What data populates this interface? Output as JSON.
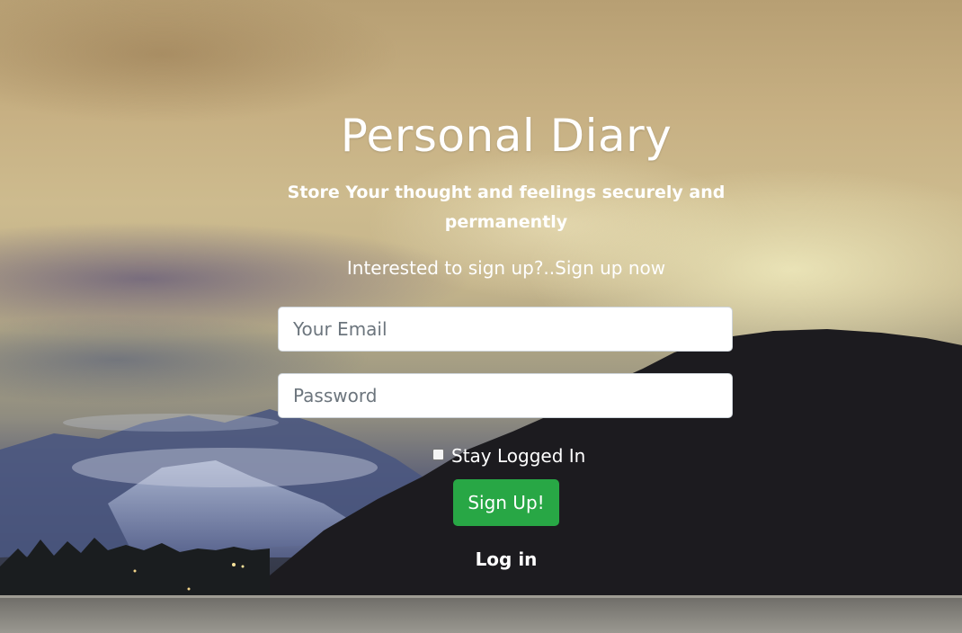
{
  "header": {
    "title": "Personal Diary",
    "subtitle": "Store Your thought and feelings securely and permanently"
  },
  "signup_form": {
    "invite_text": "Interested to sign up?..Sign up now",
    "email_placeholder": "Your Email",
    "password_placeholder": "Password",
    "stay_logged_in_label": "Stay Logged In",
    "stay_logged_in_checked": false,
    "submit_label": "Sign Up!",
    "toggle_link_label": "Log in"
  },
  "colors": {
    "submit_button": "#28a745",
    "text": "#ffffff"
  }
}
